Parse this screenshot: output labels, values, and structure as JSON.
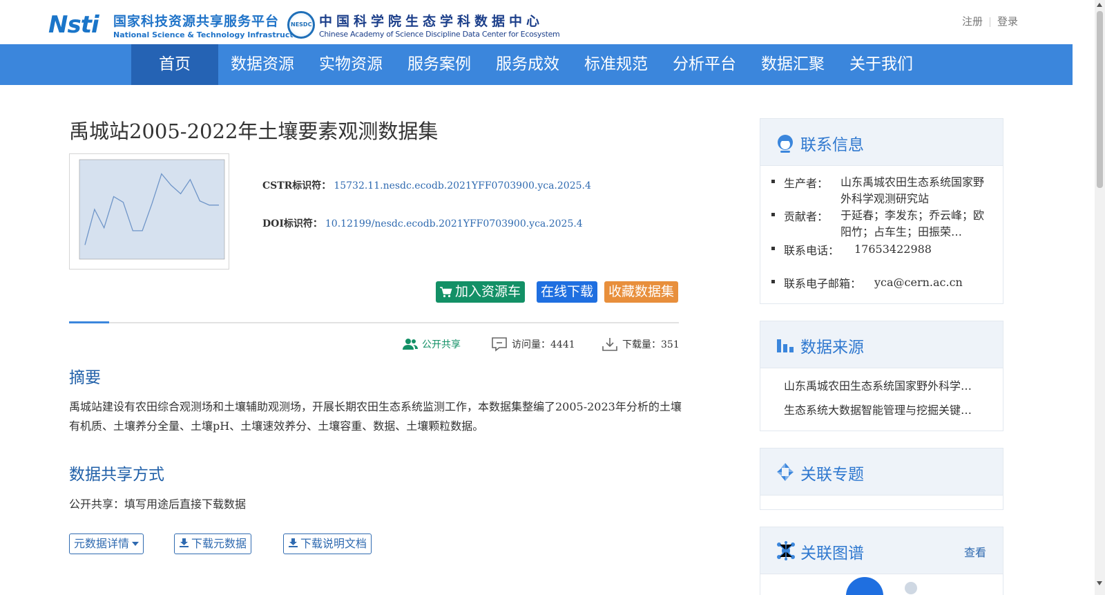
{
  "header": {
    "logo_nsti": {
      "mark": "Nsti",
      "name_cn": "国家科技资源共享服务平台",
      "name_en": "National Science & Technology Infrastructure"
    },
    "logo_nesdc": {
      "seal": "NESDC",
      "name_cn": "中国科学院生态学科数据中心",
      "name_en": "Chinese Academy of Science Discipline Data Center for Ecosystem"
    },
    "register": "注册",
    "login": "登录"
  },
  "nav": {
    "items": [
      "首页",
      "数据资源",
      "实物资源",
      "服务案例",
      "服务成效",
      "标准规范",
      "分析平台",
      "数据汇聚",
      "关于我们"
    ],
    "active_index": 0
  },
  "dataset": {
    "title": "禹城站2005-2022年土壤要素观测数据集",
    "cstr_label": "CSTR标识符：",
    "cstr_value": "15732.11.nesdc.ecodb.2021YFF0703900.yca.2025.4",
    "doi_label": "DOI标识符：",
    "doi_value": "10.12199/nesdc.ecodb.2021YFF0703900.yca.2025.4",
    "buttons": {
      "add_cart": "加入资源车",
      "download": "在线下载",
      "favorite": "收藏数据集"
    },
    "stats": {
      "share": "公开共享",
      "visits": "访问量：4441",
      "downloads": "下载量：351"
    },
    "abstract_heading": "摘要",
    "abstract": "禹城站建设有农田综合观测场和土壤辅助观测场，开展长期农田生态系统监测工作，本数据集整编了2005-2023年分析的土壤有机质、土壤养分全量、土壤pH、土壤速效养分、土壤容重、数据、土壤颗粒数据。",
    "share_heading": "数据共享方式",
    "share_text": "公开共享：填写用途后直接下载数据",
    "actions": {
      "metadata_detail": "元数据详情",
      "download_metadata": "下载元数据",
      "download_doc": "下载说明文档"
    }
  },
  "thumbnail_chart": {
    "values": [
      16,
      18.5,
      17.2,
      19.4,
      19,
      17,
      17,
      18.9,
      21,
      20.2,
      19.6,
      20.6,
      19.1,
      18.8,
      18.8
    ],
    "ylim": [
      15,
      22
    ],
    "line_color": "#6f95c8",
    "fill_color": "#d6e1ef"
  },
  "sidebar": {
    "contact": {
      "title": "联系信息",
      "producer_label": "生产者：",
      "producer": "山东禹城农田生态系统国家野外科学观测研究站",
      "contributor_label": "贡献者：",
      "contributor": "于延春；李发东；乔云峰；欧阳竹；占车生；田振荣…",
      "phone_label": "联系电话：",
      "phone": "17653422988",
      "email_label": "联系电子邮箱：",
      "email": "yca@cern.ac.cn"
    },
    "source": {
      "title": "数据来源",
      "items": [
        "山东禹城农田生态系统国家野外科学…",
        "生态系统大数据智能管理与挖掘关键…"
      ]
    },
    "topics": {
      "title": "关联专题"
    },
    "graph": {
      "title": "关联图谱",
      "more": "查看"
    }
  },
  "colors": {
    "nav_bg": "#3b86dc",
    "nav_active": "#2563b4",
    "green": "#139066",
    "blue": "#1f6fe0",
    "orange": "#e88f3c",
    "heading": "#1f5fa8"
  }
}
